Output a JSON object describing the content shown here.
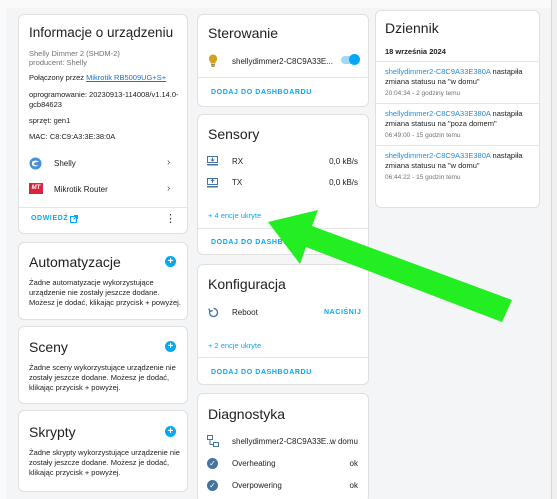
{
  "device_info": {
    "title": "Informacje o urządzeniu",
    "model": "Shelly Dimmer 2 (SHDM-2)",
    "manufacturer": "producent: Shelly",
    "connected_prefix": "Połączony przez ",
    "connected_link": "Mikrotik RB5009UG+S+",
    "firmware_line1": "oprogramowanie: 20230913-114008/v1.14.0-",
    "firmware_line2": "gcb84623",
    "hardware": "sprzęt: gen1",
    "mac": "MAC: C8:C9:A3:3E:38:0A",
    "integrations": [
      {
        "label": "Shelly",
        "icon": "shelly-icon"
      },
      {
        "label": "Mikrotik Router",
        "icon": "mikrotik-icon"
      }
    ],
    "visit_label": "ODWIEDŹ"
  },
  "automations": {
    "title": "Automatyzacje",
    "text": "Żadne automatyzacje wykorzystujące urządzenie nie zostały jeszcze dodane. Możesz je dodać, klikając przycisk + powyżej."
  },
  "scenes": {
    "title": "Sceny",
    "text": "Żadne sceny wykorzystujące urządzenie nie zostały jeszcze dodane. Możesz je dodać, klikając przycisk + powyżej."
  },
  "scripts": {
    "title": "Skrypty",
    "text": "Żadne skrypty wykorzystujące urządzenie nie zostały jeszcze dodane. Możesz je dodać, klikając przycisk + powyżej."
  },
  "controls": {
    "title": "Sterowanie",
    "entity": "shellydimmer2-C8C9A33E...",
    "add_label": "DODAJ DO DASHBOARDU"
  },
  "sensors": {
    "title": "Sensory",
    "rows": [
      {
        "label": "RX",
        "value": "0,0 kB/s"
      },
      {
        "label": "TX",
        "value": "0,0 kB/s"
      }
    ],
    "hidden_label": "+ 4 encje ukryte",
    "add_label": "DODAJ DO DASHBOARDU"
  },
  "configuration": {
    "title": "Konfiguracja",
    "reboot_label": "Reboot",
    "press_label": "NACIŚNIJ",
    "hidden_label": "+ 2 encje ukryte",
    "add_label": "DODAJ DO DASHBOARDU"
  },
  "diagnostics": {
    "title": "Diagnostyka",
    "rows": [
      {
        "label": "shellydimmer2-C8C9A33E...",
        "value": "w domu"
      },
      {
        "label": "Overheating",
        "value": "ok"
      },
      {
        "label": "Overpowering",
        "value": "ok"
      }
    ]
  },
  "logbook": {
    "title": "Dziennik",
    "date": "18 września 2024",
    "entries": [
      {
        "link": "shellydimmer2-C8C9A33E380A",
        "text1": " nastąpiła",
        "text2": "zmiana statusu na \"w domu\"",
        "time": "20:04:34 - 2 godziny temu"
      },
      {
        "link": "shellydimmer2-C8C9A33E380A",
        "text1": " nastąpiła",
        "text2": "zmiana statusu na \"poza domem\"",
        "time": "06:49:00 - 15 godzin temu"
      },
      {
        "link": "shellydimmer2-C8C9A33E380A",
        "text1": " nastąpiła",
        "text2": "zmiana statusu na \"w domu\"",
        "time": "06:44:22 - 15 godzin temu"
      }
    ]
  },
  "colors": {
    "accent": "#03a9f4",
    "annotation_arrow": "#22ee22",
    "diag_icon": "#44739e"
  }
}
